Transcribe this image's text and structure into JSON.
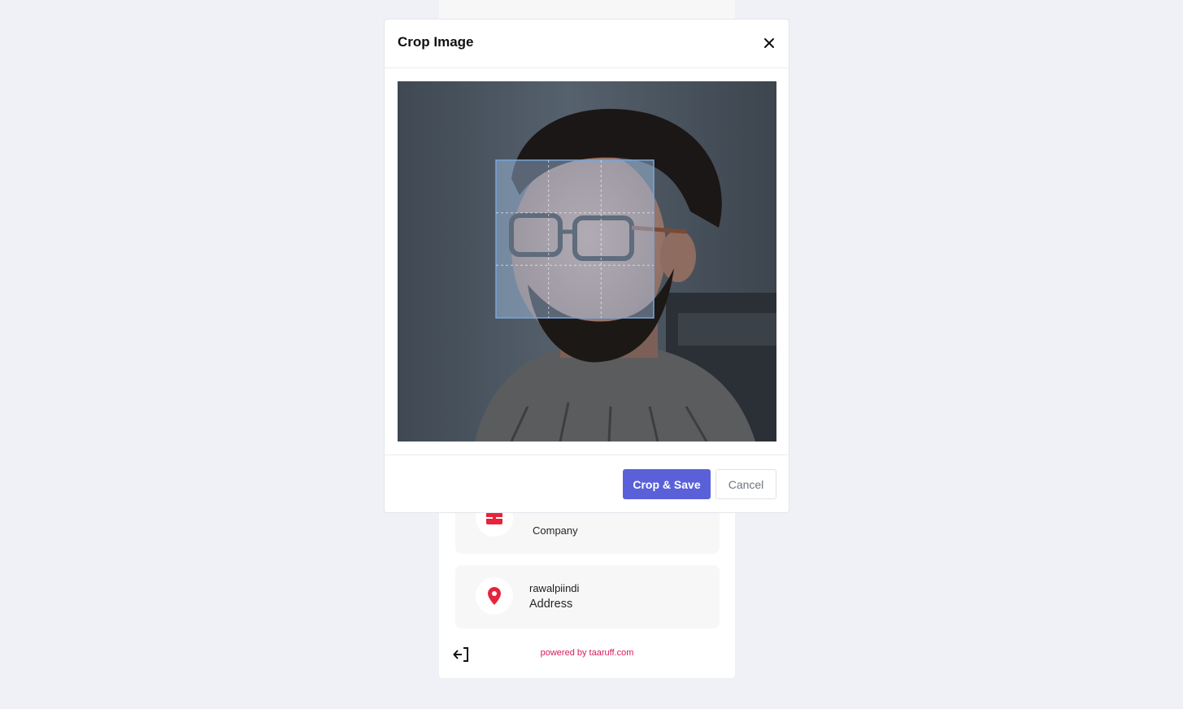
{
  "modal": {
    "title": "Crop Image",
    "save_label": "Crop & Save",
    "cancel_label": "Cancel"
  },
  "profile": {
    "company": {
      "value": "",
      "label": "Company"
    },
    "address": {
      "value": "rawalpiindi",
      "label": "Address"
    }
  },
  "footer": {
    "powered_by": "powered by taaruff.com"
  },
  "colors": {
    "primary": "#5a61d8",
    "accent_red": "#e8233c",
    "powered_text": "#d81b60"
  }
}
